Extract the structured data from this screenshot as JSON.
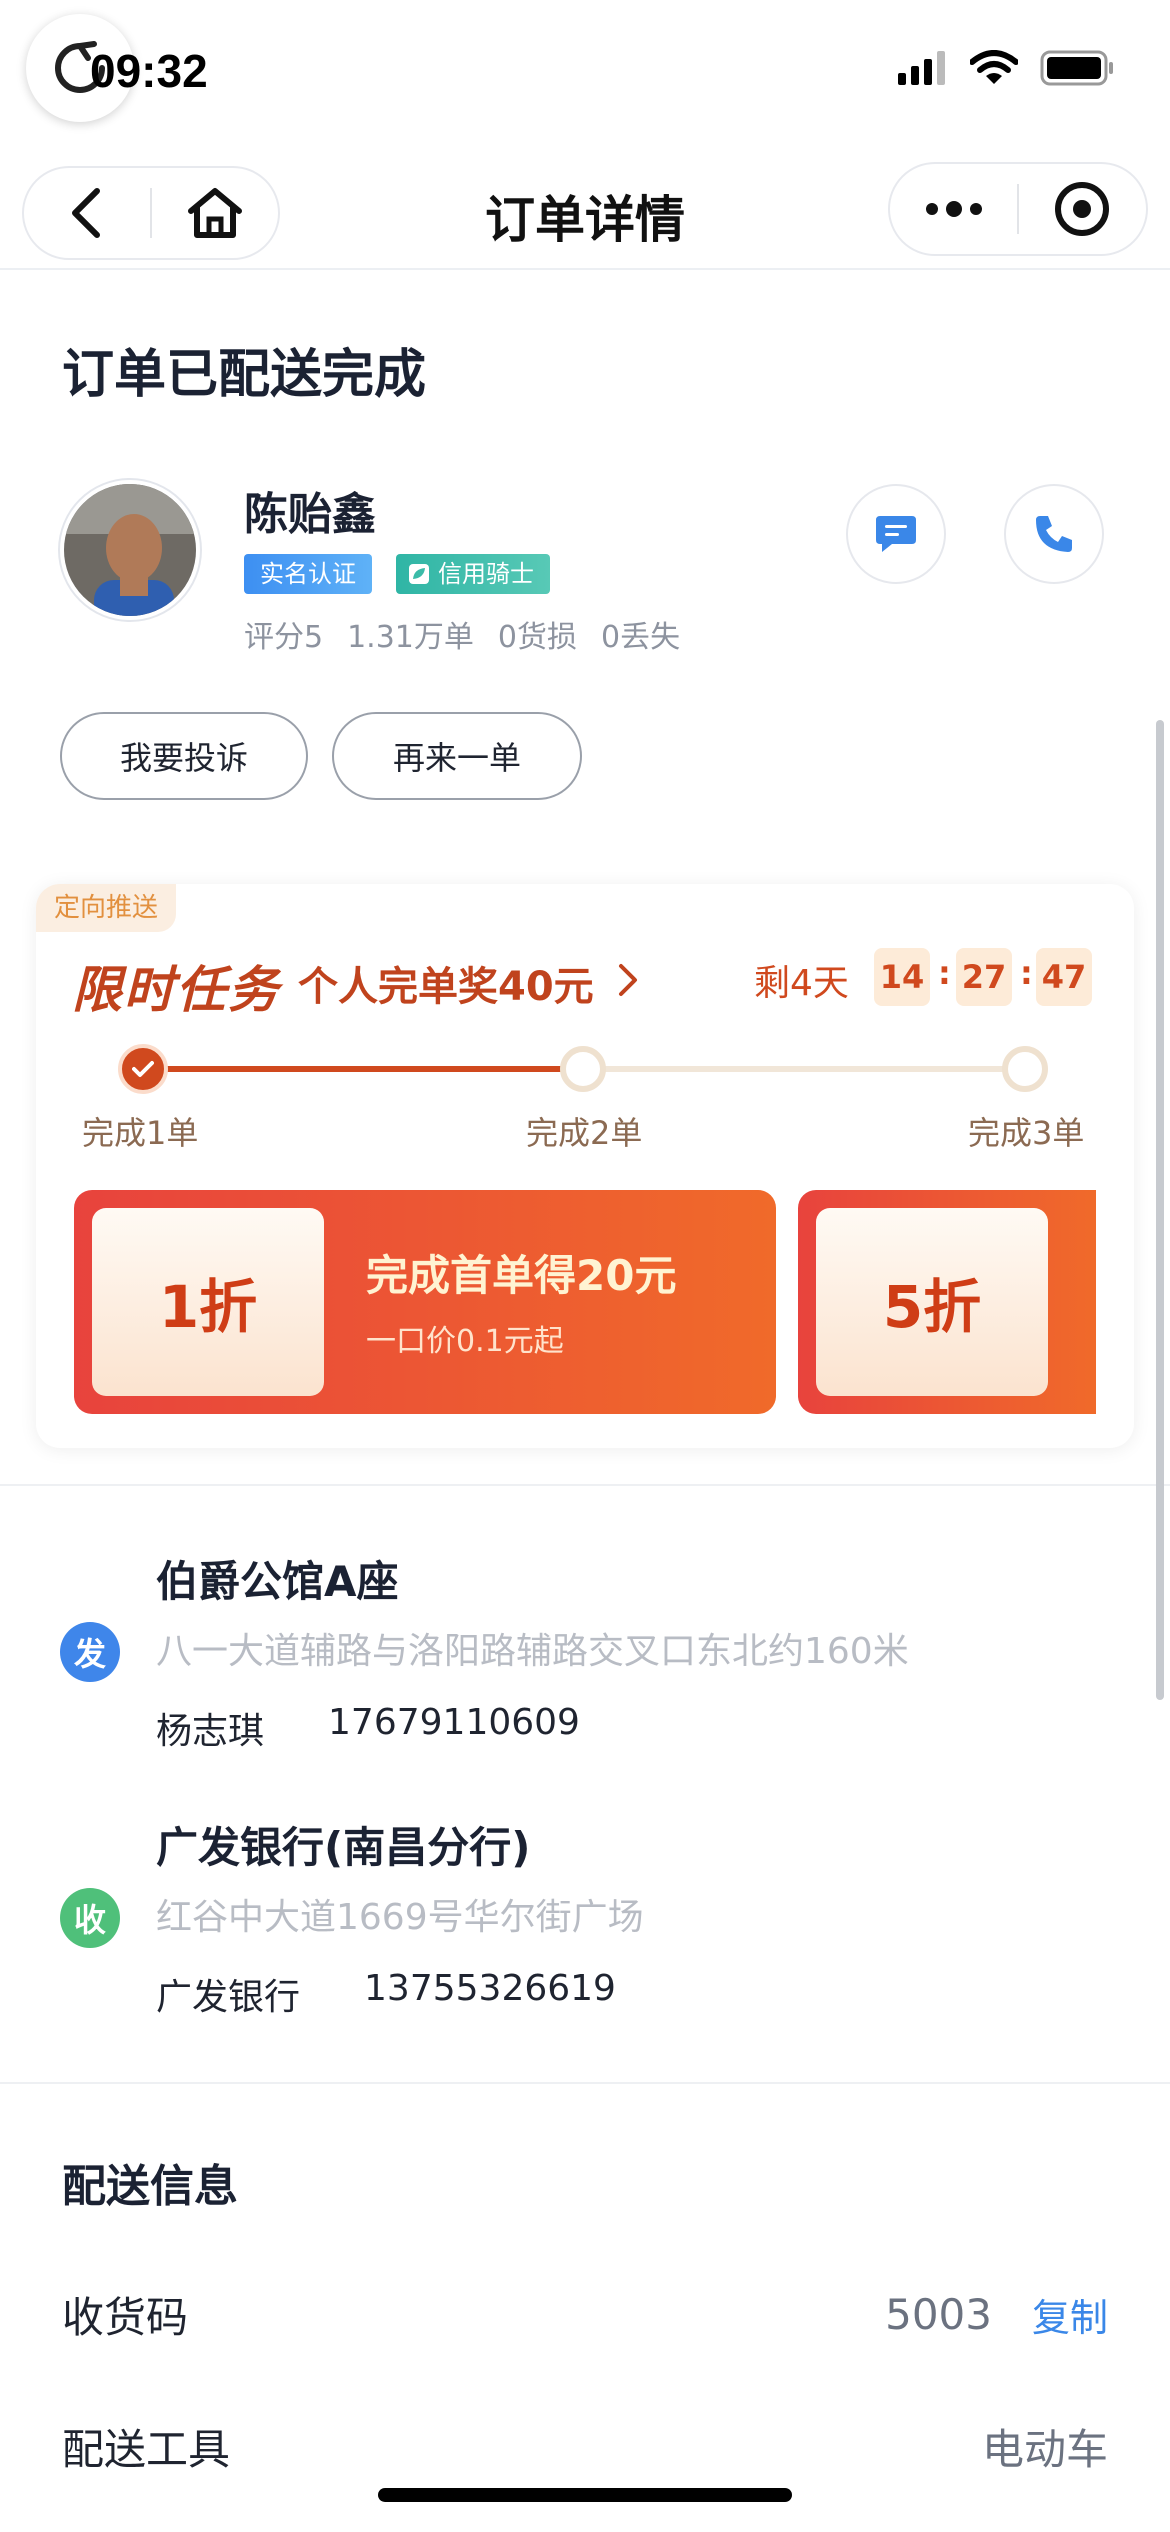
{
  "status_bar": {
    "time": "09:32"
  },
  "nav": {
    "title": "订单详情"
  },
  "order": {
    "status_title": "订单已配送完成"
  },
  "rider": {
    "name": "陈贻鑫",
    "badge_verified": "实名认证",
    "badge_credit": "信用骑士",
    "stats": [
      "评分5",
      "1.31万单",
      "0货损",
      "0丢失"
    ]
  },
  "actions": {
    "complain": "我要投诉",
    "reorder": "再来一单"
  },
  "promo": {
    "tag": "定向推送",
    "title": "限时任务",
    "subtitle": "个人完单奖40元",
    "remain": "剩4天",
    "countdown": {
      "h": "14",
      "m": "27",
      "s": "47"
    },
    "separator": ":",
    "steps": [
      "完成1单",
      "完成2单",
      "完成3单"
    ],
    "progress_completed_steps": 1,
    "coupons": [
      {
        "discount": "1折",
        "title": "完成首单得20元",
        "sub": "一口价0.1元起"
      },
      {
        "discount": "5折"
      }
    ]
  },
  "sender": {
    "badge": "发",
    "name": "伯爵公馆A座",
    "detail": "八一大道辅路与洛阳路辅路交叉口东北约160米",
    "contact_name": "杨志琪",
    "phone": "17679110609"
  },
  "receiver": {
    "badge": "收",
    "name": "广发银行(南昌分行)",
    "detail": "红谷中大道1669号华尔街广场",
    "contact_name": "广发银行",
    "phone": "13755326619"
  },
  "delivery_info": {
    "heading": "配送信息",
    "code_label": "收货码",
    "code_value": "5003",
    "copy_label": "复制",
    "tool_label": "配送工具",
    "tool_value": "电动车"
  },
  "colors": {
    "accent_orange": "#d0491e",
    "link_blue": "#3a87e8",
    "sender_blue": "#3f86ea",
    "receiver_green": "#4fc07a"
  }
}
